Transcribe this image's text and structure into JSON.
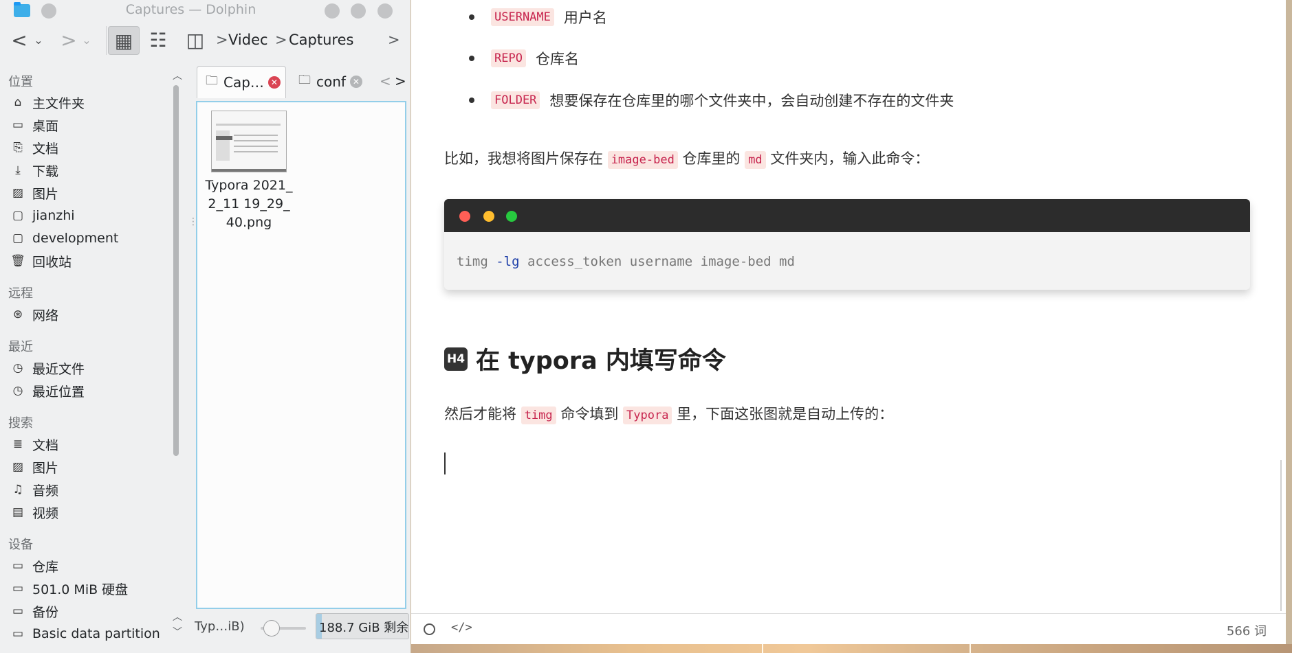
{
  "dolphin": {
    "window_title": "Captures — Dolphin",
    "toolbar": {
      "back_label": "<",
      "forward_label": ">",
      "dropdown_label": "⌄",
      "icons_view_label": "▦",
      "details_view_label": "☷",
      "split_view_label": "◫",
      "crumb_sep": ">",
      "more_label": ">"
    },
    "breadcrumb": [
      "Videc",
      "Captures"
    ],
    "places": {
      "groups": [
        {
          "title": "位置",
          "items": [
            {
              "icon": "⌂",
              "label": "主文件夹"
            },
            {
              "icon": "▭",
              "label": "桌面"
            },
            {
              "icon": "⎘",
              "label": "文档"
            },
            {
              "icon": "⤓",
              "label": "下载"
            },
            {
              "icon": "▨",
              "label": "图片"
            },
            {
              "icon": "▢",
              "label": "jianzhi"
            },
            {
              "icon": "▢",
              "label": "development"
            },
            {
              "icon": "🗑",
              "label": "回收站"
            }
          ]
        },
        {
          "title": "远程",
          "items": [
            {
              "icon": "⊛",
              "label": "网络"
            }
          ]
        },
        {
          "title": "最近",
          "items": [
            {
              "icon": "◷",
              "label": "最近文件"
            },
            {
              "icon": "◷",
              "label": "最近位置"
            }
          ]
        },
        {
          "title": "搜索",
          "items": [
            {
              "icon": "≣",
              "label": "文档"
            },
            {
              "icon": "▨",
              "label": "图片"
            },
            {
              "icon": "♫",
              "label": "音频"
            },
            {
              "icon": "▤",
              "label": "视频"
            }
          ]
        },
        {
          "title": "设备",
          "items": [
            {
              "icon": "▭",
              "label": "仓库"
            },
            {
              "icon": "▭",
              "label": "501.0 MiB 硬盘"
            },
            {
              "icon": "▭",
              "label": "备份"
            },
            {
              "icon": "▭",
              "label": "Basic data partition"
            }
          ]
        }
      ]
    },
    "tabs": [
      {
        "label": "Cap…",
        "close": "✕"
      },
      {
        "label": "conf",
        "close": "✕"
      }
    ],
    "tab_nav_left": "<",
    "tab_nav_right": ">",
    "files": [
      {
        "name": "Typora 2021_2_11 19_29_40.png"
      }
    ],
    "status": {
      "text": "Typ…iB)",
      "free_space": "188.7 GiB 剩余",
      "used_fraction": 0.06
    }
  },
  "typora": {
    "bullets": [
      {
        "code": "USERNAME",
        "text": "用户名"
      },
      {
        "code": "REPO",
        "text": "仓库名"
      },
      {
        "code": "FOLDER",
        "text": "想要保存在仓库里的哪个文件夹中，会自动创建不存在的文件夹"
      }
    ],
    "para1": {
      "t1": "比如，我想将图片保存在",
      "c1": "image-bed",
      "t2": "仓库里的",
      "c2": "md",
      "t3": "文件夹内，输入此命令："
    },
    "codeblock": {
      "cmd": "timg",
      "flag": "-lg",
      "args": "access_token username image-bed md"
    },
    "heading": {
      "badge": "H4",
      "text": "在 typora 内填写命令"
    },
    "para2": {
      "t1": "然后才能将",
      "c1": "timg",
      "t2": "命令填到",
      "c2": "Typora",
      "t3": "里，下面这张图就是自动上传的："
    },
    "status": {
      "source_label": "</>",
      "word_count": "566 词"
    }
  },
  "colors": {
    "accent": "#3daee9",
    "code_text": "#c7254e",
    "code_bg": "#fbe5e1",
    "traffic_red": "#ff5f56",
    "traffic_yellow": "#ffbd2e",
    "traffic_green": "#27c93f"
  }
}
